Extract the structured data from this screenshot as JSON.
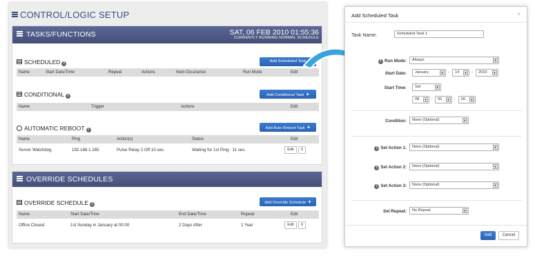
{
  "page_title": "CONTROL/LOGIC SETUP",
  "tasks": {
    "banner_title": "TASKS/FUNCTIONS",
    "datetime": "SAT, 06 FEB 2010 01:55:36",
    "subtitle": "CURRENTLY RUNNING NORMAL SCHEDULE",
    "scheduled": {
      "title": "SCHEDULED",
      "button": "Add Scheduled Task",
      "columns": [
        "Name",
        "Start Date/Time",
        "Repeat",
        "Actions",
        "Next Occurance",
        "Run Mode",
        "Edit"
      ]
    },
    "conditional": {
      "title": "CONDITIONAL",
      "button": "Add Conditional Task",
      "columns": [
        "Name",
        "Trigger",
        "Actions",
        "Edit"
      ]
    },
    "reboot": {
      "title": "AUTOMATIC REBOOT",
      "button": "Add Auto Reboot Task",
      "columns": [
        "Name",
        "Ping",
        "Action(s)",
        "Status",
        "Edit"
      ],
      "rows": [
        {
          "name": "Server Watchdog",
          "ping": "192.168.1.165",
          "actions": "Pulse Relay 2 Off 10 sec.",
          "status": "Waiting for 1st Ping : 11 sec.",
          "edit": "Edit",
          "del": "X"
        }
      ]
    }
  },
  "override": {
    "banner_title": "OVERRIDE SCHEDULES",
    "section_title": "OVERRIDE SCHEDULE",
    "button": "Add Override Schedule",
    "columns": [
      "Name",
      "Start Date/Time",
      "End Date/Time",
      "Repeat",
      "Edit"
    ],
    "rows": [
      {
        "name": "Office Closed",
        "start": "1st Sunday in January at 00:00",
        "end": "2 Days After",
        "repeat": "1 Year",
        "edit": "Edit",
        "del": "X"
      }
    ]
  },
  "modal": {
    "title": "Add Scheduled Task",
    "close": "×",
    "task_name_label": "Task Name:",
    "task_name_value": "Scheduled Task 1",
    "run_mode_label": "Run Mode:",
    "run_mode_value": "Always",
    "start_date_label": "Start Date:",
    "start_month": "January",
    "start_day": "14",
    "start_year": "2010",
    "start_time_label": "Start Time:",
    "start_time_mode": "Set",
    "time_hour": "08",
    "time_min": "00",
    "time_sec": "00",
    "condition_label": "Condition:",
    "condition_value": "None (Optional)",
    "action1_label": "Set Action 1:",
    "action1_value": "None (Optional)",
    "action2_label": "Set Action 2:",
    "action2_value": "None (Optional)",
    "action3_label": "Set Action 3:",
    "action3_value": "None (Optional)",
    "repeat_label": "Set Repeat:",
    "repeat_value": "No Repeat",
    "add_button": "Add",
    "cancel_button": "Cancel"
  },
  "colors": {
    "banner": "#4f5a85",
    "accent_blue": "#2f6dc2",
    "arrow": "#3aa3de"
  }
}
